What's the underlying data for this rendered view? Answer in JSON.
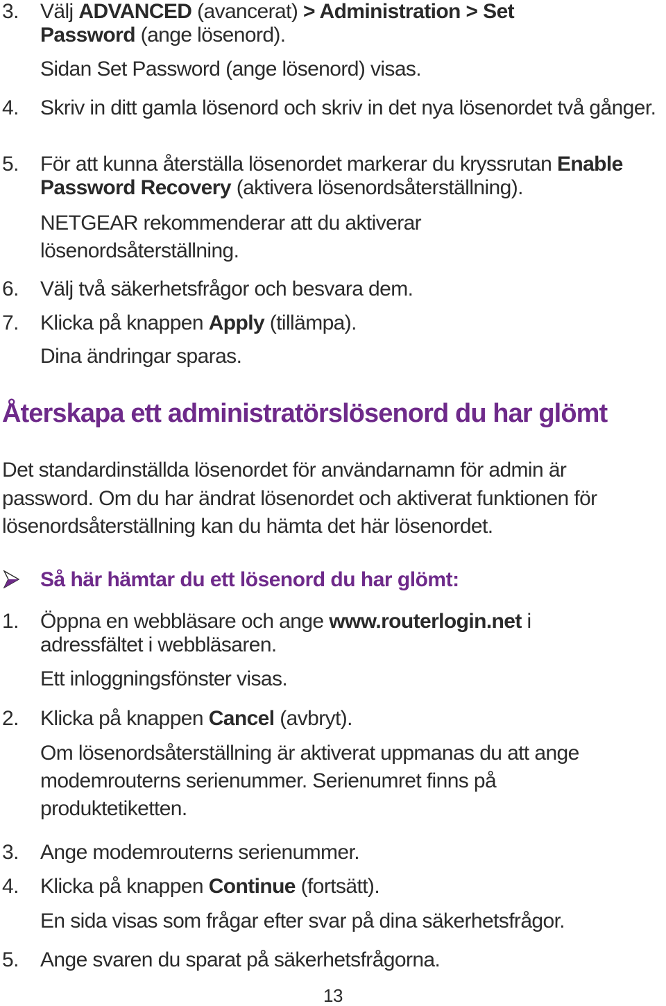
{
  "colors": {
    "text": "#2b2b2b",
    "heading": "#6e2a8a"
  },
  "steps_top": [
    {
      "number": "3.",
      "parts": [
        {
          "text": "Välj ",
          "bold": false
        },
        {
          "text": "ADVANCED",
          "bold": true
        },
        {
          "text": " (avancerat) ",
          "bold": false
        },
        {
          "text": "> Administration > Set Password",
          "bold": true
        },
        {
          "text": " (ange lösenord).",
          "bold": false
        }
      ],
      "note": "Sidan Set Password (ange lösenord) visas."
    },
    {
      "number": "4.",
      "parts": [
        {
          "text": "Skriv in ditt gamla lösenord och skriv in det nya lösenordet två gånger.",
          "bold": false
        }
      ]
    },
    {
      "number": "5.",
      "parts": [
        {
          "text": "För att kunna återställa lösenordet markerar du kryssrutan ",
          "bold": false
        },
        {
          "text": "Enable Password Recovery",
          "bold": true
        },
        {
          "text": " (aktivera lösenordsåterställning).",
          "bold": false
        }
      ],
      "note": "NETGEAR rekommenderar att du aktiverar lösenordsåterställning."
    },
    {
      "number": "6.",
      "parts": [
        {
          "text": "Välj två säkerhetsfrågor och besvara dem.",
          "bold": false
        }
      ]
    },
    {
      "number": "7.",
      "parts": [
        {
          "text": "Klicka på knappen ",
          "bold": false
        },
        {
          "text": "Apply",
          "bold": true
        },
        {
          "text": " (tillämpa).",
          "bold": false
        }
      ],
      "note": "Dina ändringar sparas."
    }
  ],
  "section": {
    "heading": "Återskapa ett administratörslösenord du har glömt",
    "paragraph": "Det standardinställda lösenordet för användarnamn för admin är password. Om du har ändrat lösenordet och aktiverat funktionen för lösenordsåterställning kan du hämta det här lösenordet.",
    "subheading_icon": "arrowhead-bullet-icon",
    "subheading": "Så här hämtar du ett lösenord du har glömt:"
  },
  "steps_bottom": [
    {
      "number": "1.",
      "parts": [
        {
          "text": "Öppna en webbläsare och ange ",
          "bold": false
        },
        {
          "text": "www.routerlogin.net",
          "bold": true
        },
        {
          "text": " i adressfältet i webbläsaren.",
          "bold": false
        }
      ],
      "note": "Ett inloggningsfönster visas."
    },
    {
      "number": "2.",
      "parts": [
        {
          "text": "Klicka på knappen ",
          "bold": false
        },
        {
          "text": "Cancel",
          "bold": true
        },
        {
          "text": " (avbryt).",
          "bold": false
        }
      ],
      "note": "Om lösenordsåterställning är aktiverat uppmanas du att ange modemrouterns serienummer. Serienumret finns på produktetiketten."
    },
    {
      "number": "3.",
      "parts": [
        {
          "text": "Ange modemrouterns serienummer.",
          "bold": false
        }
      ]
    },
    {
      "number": "4.",
      "parts": [
        {
          "text": "Klicka på knappen ",
          "bold": false
        },
        {
          "text": "Continue",
          "bold": true
        },
        {
          "text": " (fortsätt).",
          "bold": false
        }
      ],
      "note": "En sida visas som frågar efter svar på dina säkerhetsfrågor."
    },
    {
      "number": "5.",
      "parts": [
        {
          "text": "Ange svaren du sparat på säkerhetsfrågorna.",
          "bold": false
        }
      ]
    }
  ],
  "page_number": "13"
}
